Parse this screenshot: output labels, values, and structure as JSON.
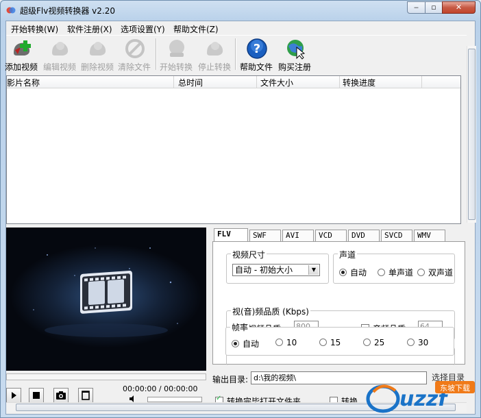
{
  "window": {
    "title": "超级Flv视频转换器 v2.20",
    "min_glyph": "‒",
    "max_glyph": "▫",
    "close_glyph": "✕"
  },
  "menu": [
    "开始转换(W)",
    "软件注册(X)",
    "选项设置(Y)",
    "帮助文件(Z)"
  ],
  "toolbar": {
    "add_video": "添加视频",
    "edit_video": "编辑视频",
    "delete_video": "删除视频",
    "clear_files": "清除文件",
    "start_convert": "开始转换",
    "stop_convert": "停止转换",
    "help_file": "帮助文件",
    "buy_register": "购买注册"
  },
  "file_list": {
    "columns": [
      "影片名称",
      "总时间",
      "文件大小",
      "转换进度"
    ],
    "rows": []
  },
  "player": {
    "time": "00:00:00 / 00:00:00"
  },
  "format_tabs": [
    "FLV",
    "SWF",
    "AVI",
    "VCD",
    "DVD",
    "SVCD",
    "WMV"
  ],
  "active_tab": "FLV",
  "settings": {
    "video_size": {
      "title": "视频尺寸",
      "selected": "自动 - 初始大小"
    },
    "audio_channel": {
      "title": "声道",
      "options": [
        "自动",
        "单声道",
        "双声道"
      ],
      "selected": "自动"
    },
    "quality": {
      "title": "视(音)频品质 (Kbps)",
      "video_label": "视频品质",
      "video_value": "800",
      "audio_label": "音频品质",
      "audio_value": "64"
    },
    "frame_rate": {
      "title": "帧率",
      "options": [
        "自动",
        "10",
        "15",
        "25",
        "30"
      ],
      "selected": "自动"
    }
  },
  "output": {
    "label": "输出目录:",
    "path": "d:\\我的视频\\",
    "browse_button": "选择目录"
  },
  "bottom_options": {
    "open_folder": "转换完毕打开文件夹",
    "second": "转换"
  },
  "watermark": {
    "text": "uzzf.com",
    "subtext": "东坡下载"
  },
  "colors": {
    "accent_blue": "#1a73c8",
    "watermark_orange": "#f07a18",
    "close_red": "#c7452c"
  }
}
